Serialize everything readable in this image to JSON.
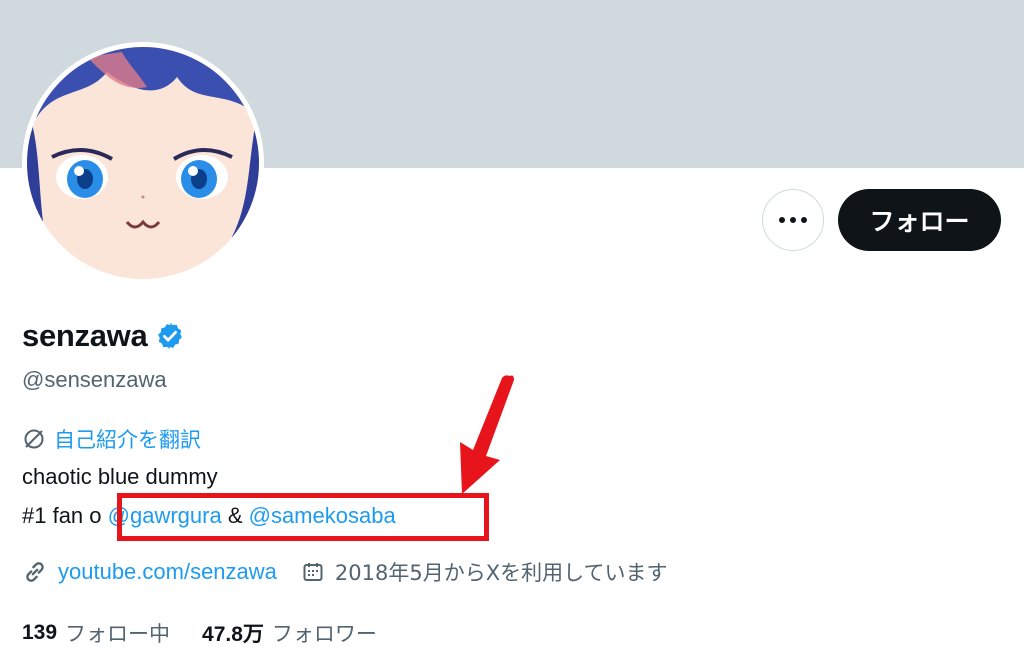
{
  "profile": {
    "display_name": "senzawa",
    "handle": "@sensenzawa",
    "verified": true
  },
  "actions": {
    "more_label": "More",
    "follow_label": "フォロー"
  },
  "bio": {
    "translate_label": "自己紹介を翻訳",
    "line1": "chaotic blue dummy",
    "line2_prefix": "#1 fan o",
    "mention1": "@gawrgura",
    "ampersand": " & ",
    "mention2": "@samekosaba"
  },
  "meta": {
    "website": "youtube.com/senzawa",
    "joined": "2018年5月からXを利用しています"
  },
  "stats": {
    "following_count": "139",
    "following_label": "フォロー中",
    "followers_count": "47.8万",
    "followers_label": "フォロワー"
  },
  "colors": {
    "accent": "#1d9bf0",
    "banner": "#cfd9de",
    "annotation": "#e8141b"
  },
  "icons": [
    "more-icon",
    "verified-badge-icon",
    "translate-icon",
    "link-icon",
    "calendar-icon"
  ]
}
